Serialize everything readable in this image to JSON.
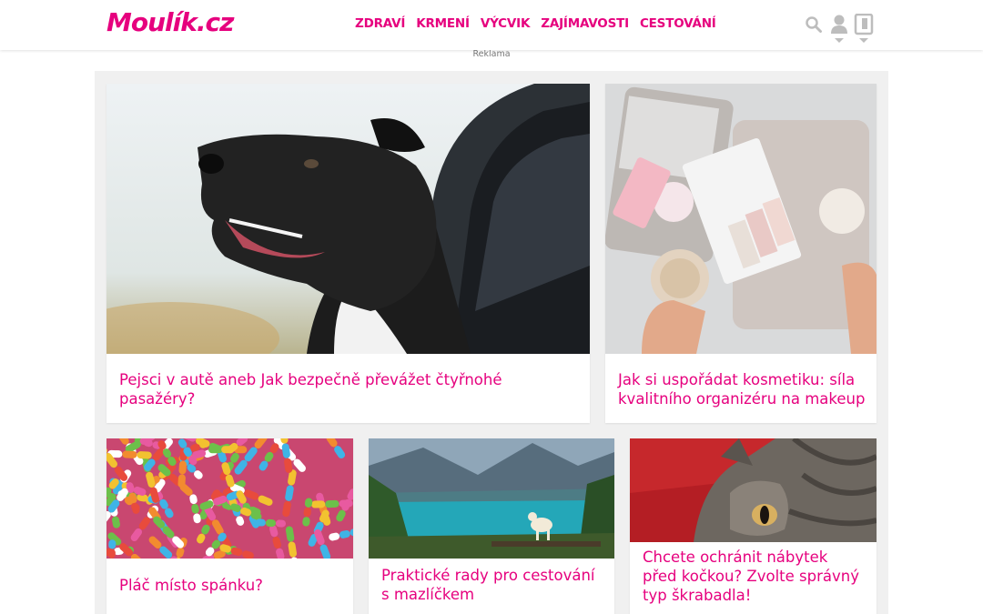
{
  "site": {
    "logo": "Moulík.cz",
    "brand_color": "#e6007e"
  },
  "nav": {
    "items": [
      {
        "label": "ZDRAVÍ"
      },
      {
        "label": "KRMENÍ"
      },
      {
        "label": "VÝCVIK"
      },
      {
        "label": "ZAJÍMAVOSTI"
      },
      {
        "label": "CESTOVÁNÍ"
      }
    ]
  },
  "tools": {
    "search_icon": "search-icon",
    "user_icon": "user-icon",
    "login_icon": "login-icon"
  },
  "ad": {
    "label": "Reklama"
  },
  "articles": [
    {
      "title": "Pejsci v autě aneb Jak bezpečně převážet čtyřnohé pasažéry?"
    },
    {
      "title": "Jak si uspořádat kosmetiku: síla kvalitního organizéru na makeup"
    },
    {
      "title": "Pláč místo spánku?"
    },
    {
      "title": "Praktické rady pro cestování s mazlíčkem"
    },
    {
      "title": "Chcete ochránit nábytek před kočkou? Zvolte správný typ škrabadla!"
    }
  ]
}
